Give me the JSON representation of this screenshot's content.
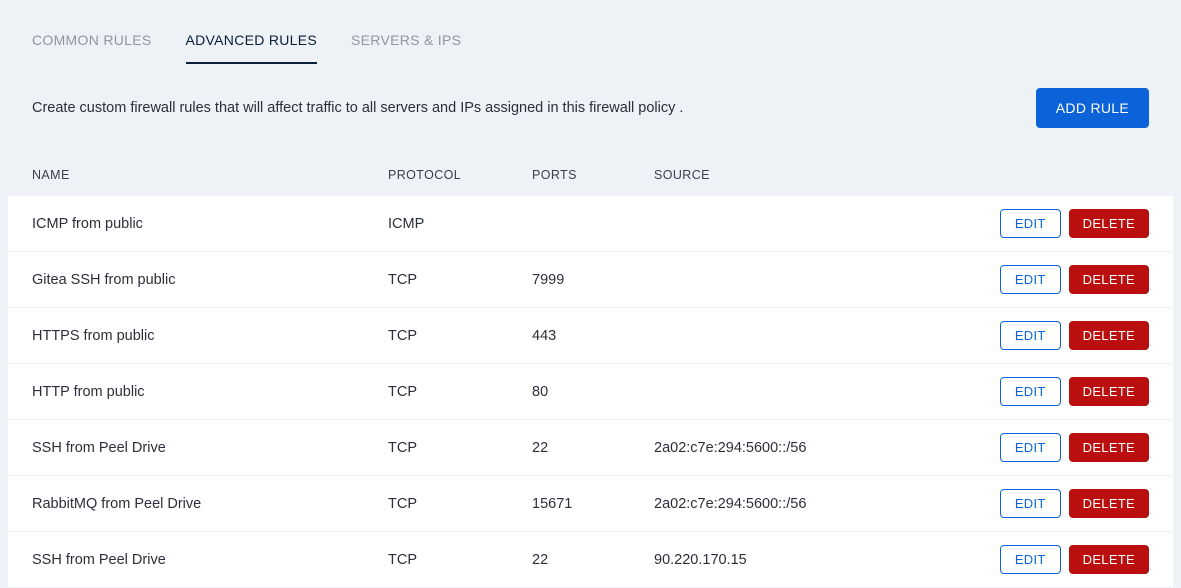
{
  "tabs": [
    {
      "label": "COMMON RULES",
      "active": false
    },
    {
      "label": "ADVANCED RULES",
      "active": true
    },
    {
      "label": "SERVERS & IPS",
      "active": false
    }
  ],
  "description": "Create custom firewall rules that will affect traffic to all servers and IPs assigned in this firewall policy .",
  "add_rule_label": "ADD RULE",
  "columns": {
    "name": "NAME",
    "protocol": "PROTOCOL",
    "ports": "PORTS",
    "source": "SOURCE"
  },
  "buttons": {
    "edit": "EDIT",
    "delete": "DELETE"
  },
  "rules": [
    {
      "name": "ICMP from public",
      "protocol": "ICMP",
      "ports": "",
      "source": ""
    },
    {
      "name": "Gitea SSH from public",
      "protocol": "TCP",
      "ports": "7999",
      "source": ""
    },
    {
      "name": "HTTPS from public",
      "protocol": "TCP",
      "ports": "443",
      "source": ""
    },
    {
      "name": "HTTP from public",
      "protocol": "TCP",
      "ports": "80",
      "source": ""
    },
    {
      "name": "SSH from Peel Drive",
      "protocol": "TCP",
      "ports": "22",
      "source": "2a02:c7e:294:5600::/56"
    },
    {
      "name": "RabbitMQ from Peel Drive",
      "protocol": "TCP",
      "ports": "15671",
      "source": "2a02:c7e:294:5600::/56"
    },
    {
      "name": "SSH from Peel Drive",
      "protocol": "TCP",
      "ports": "22",
      "source": "90.220.170.15"
    }
  ]
}
